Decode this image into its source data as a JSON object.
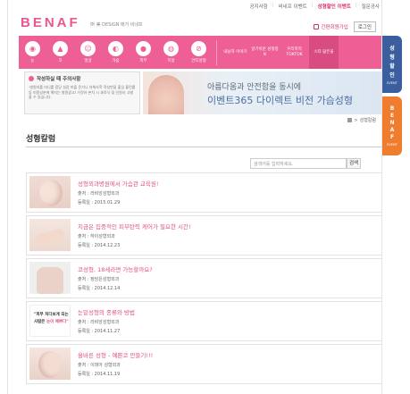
{
  "toplinks": [
    "공지사항",
    "비네프 이벤트",
    "성형할인 이벤트",
    "질문공사"
  ],
  "brand": {
    "logo": "BENAF",
    "subtitle": "㈜ 美 DESIGN 매거 비네프"
  },
  "header": {
    "consult": "간편회원가입",
    "login": "로그인"
  },
  "nav": {
    "icons": [
      {
        "label": "눈",
        "glyph": "◉"
      },
      {
        "label": "코",
        "glyph": "▲"
      },
      {
        "label": "얼굴",
        "glyph": "☺"
      },
      {
        "label": "가슴",
        "glyph": "◐"
      },
      {
        "label": "피부",
        "glyph": "●"
      },
      {
        "label": "지방",
        "glyph": "◍"
      },
      {
        "label": "안티성형",
        "glyph": "⊘"
      }
    ],
    "text_items": [
      "내남자 이야기",
      "알기쉬운 성형정보",
      "우리학지 TOKTOK",
      "스타 닮은꼴"
    ]
  },
  "sidetabs": {
    "tab1": [
      "성",
      "형",
      "할",
      "인"
    ],
    "tab2": [
      "B",
      "E",
      "N",
      "A",
      "F"
    ],
    "more": "EVENT"
  },
  "notice": {
    "title": "작성하실 때 주의사항",
    "body": "·병원지를 미니를 힘당 실장 미플 운기니 자체사학 작성만을 출입 블린를 등 미용성분에 해지는 병원광고/ 거짓하 본치 시 과로식 및 인원사 고발을 수 있습니다."
  },
  "banner": {
    "line1": "아름다움과 안전함을 동시에",
    "line2": "이벤트365 다이렉트 비전 가슴성형"
  },
  "breadcrumb": {
    "current": "성형칼럼"
  },
  "page_title": "성형칼럼",
  "search": {
    "placeholder": "검색어를 입력하세요.",
    "button": "검색"
  },
  "articles": [
    {
      "title": "성형외과병원에서 가슴관 교육원!",
      "source": "출처 : 라비앙성형외과",
      "date": "등록일 : 2015.01.29",
      "thumb": "face"
    },
    {
      "title": "지금은 집중적인 피부탄력 케어가 필요한 시간!",
      "source": "출처 : 하이성형외과",
      "date": "등록일 : 2014.12.23",
      "thumb": "hand"
    },
    {
      "title": "코성형, 18세라면 가능할까요?",
      "source": "출처 : 정담은성형외과",
      "date": "등록일 : 2014.12.14",
      "thumb": "back"
    },
    {
      "title": "눈밑성형의 종류와 방법",
      "source": "출처 : 라비앙성형외과",
      "date": "등록일 : 2014.11.27",
      "thumb": "text",
      "thumb_text1": "\"피부 처다보게 되는",
      "thumb_text2": "사람은 ",
      "thumb_text_hl": "눈이 예쁘다\""
    },
    {
      "title": "올바른 성형 - 예쁜코 만들기!!!",
      "source": "출처 : 이데아 성형외과",
      "date": "등록일 : 2014.11.19",
      "thumb": "nose"
    }
  ]
}
